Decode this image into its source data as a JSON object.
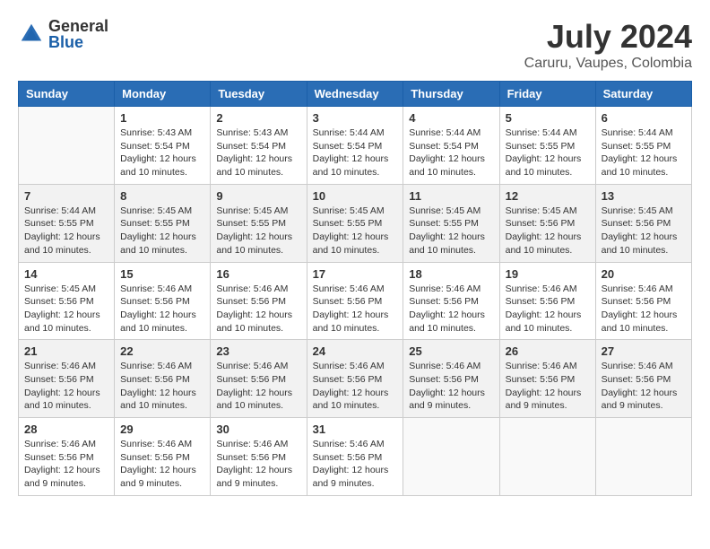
{
  "logo": {
    "general": "General",
    "blue": "Blue"
  },
  "title": "July 2024",
  "location": "Caruru, Vaupes, Colombia",
  "days_of_week": [
    "Sunday",
    "Monday",
    "Tuesday",
    "Wednesday",
    "Thursday",
    "Friday",
    "Saturday"
  ],
  "weeks": [
    [
      {
        "day": "",
        "info": ""
      },
      {
        "day": "1",
        "info": "Sunrise: 5:43 AM\nSunset: 5:54 PM\nDaylight: 12 hours\nand 10 minutes."
      },
      {
        "day": "2",
        "info": "Sunrise: 5:43 AM\nSunset: 5:54 PM\nDaylight: 12 hours\nand 10 minutes."
      },
      {
        "day": "3",
        "info": "Sunrise: 5:44 AM\nSunset: 5:54 PM\nDaylight: 12 hours\nand 10 minutes."
      },
      {
        "day": "4",
        "info": "Sunrise: 5:44 AM\nSunset: 5:54 PM\nDaylight: 12 hours\nand 10 minutes."
      },
      {
        "day": "5",
        "info": "Sunrise: 5:44 AM\nSunset: 5:55 PM\nDaylight: 12 hours\nand 10 minutes."
      },
      {
        "day": "6",
        "info": "Sunrise: 5:44 AM\nSunset: 5:55 PM\nDaylight: 12 hours\nand 10 minutes."
      }
    ],
    [
      {
        "day": "7",
        "info": "Sunrise: 5:44 AM\nSunset: 5:55 PM\nDaylight: 12 hours\nand 10 minutes."
      },
      {
        "day": "8",
        "info": "Sunrise: 5:45 AM\nSunset: 5:55 PM\nDaylight: 12 hours\nand 10 minutes."
      },
      {
        "day": "9",
        "info": "Sunrise: 5:45 AM\nSunset: 5:55 PM\nDaylight: 12 hours\nand 10 minutes."
      },
      {
        "day": "10",
        "info": "Sunrise: 5:45 AM\nSunset: 5:55 PM\nDaylight: 12 hours\nand 10 minutes."
      },
      {
        "day": "11",
        "info": "Sunrise: 5:45 AM\nSunset: 5:55 PM\nDaylight: 12 hours\nand 10 minutes."
      },
      {
        "day": "12",
        "info": "Sunrise: 5:45 AM\nSunset: 5:56 PM\nDaylight: 12 hours\nand 10 minutes."
      },
      {
        "day": "13",
        "info": "Sunrise: 5:45 AM\nSunset: 5:56 PM\nDaylight: 12 hours\nand 10 minutes."
      }
    ],
    [
      {
        "day": "14",
        "info": "Sunrise: 5:45 AM\nSunset: 5:56 PM\nDaylight: 12 hours\nand 10 minutes."
      },
      {
        "day": "15",
        "info": "Sunrise: 5:46 AM\nSunset: 5:56 PM\nDaylight: 12 hours\nand 10 minutes."
      },
      {
        "day": "16",
        "info": "Sunrise: 5:46 AM\nSunset: 5:56 PM\nDaylight: 12 hours\nand 10 minutes."
      },
      {
        "day": "17",
        "info": "Sunrise: 5:46 AM\nSunset: 5:56 PM\nDaylight: 12 hours\nand 10 minutes."
      },
      {
        "day": "18",
        "info": "Sunrise: 5:46 AM\nSunset: 5:56 PM\nDaylight: 12 hours\nand 10 minutes."
      },
      {
        "day": "19",
        "info": "Sunrise: 5:46 AM\nSunset: 5:56 PM\nDaylight: 12 hours\nand 10 minutes."
      },
      {
        "day": "20",
        "info": "Sunrise: 5:46 AM\nSunset: 5:56 PM\nDaylight: 12 hours\nand 10 minutes."
      }
    ],
    [
      {
        "day": "21",
        "info": "Sunrise: 5:46 AM\nSunset: 5:56 PM\nDaylight: 12 hours\nand 10 minutes."
      },
      {
        "day": "22",
        "info": "Sunrise: 5:46 AM\nSunset: 5:56 PM\nDaylight: 12 hours\nand 10 minutes."
      },
      {
        "day": "23",
        "info": "Sunrise: 5:46 AM\nSunset: 5:56 PM\nDaylight: 12 hours\nand 10 minutes."
      },
      {
        "day": "24",
        "info": "Sunrise: 5:46 AM\nSunset: 5:56 PM\nDaylight: 12 hours\nand 10 minutes."
      },
      {
        "day": "25",
        "info": "Sunrise: 5:46 AM\nSunset: 5:56 PM\nDaylight: 12 hours\nand 9 minutes."
      },
      {
        "day": "26",
        "info": "Sunrise: 5:46 AM\nSunset: 5:56 PM\nDaylight: 12 hours\nand 9 minutes."
      },
      {
        "day": "27",
        "info": "Sunrise: 5:46 AM\nSunset: 5:56 PM\nDaylight: 12 hours\nand 9 minutes."
      }
    ],
    [
      {
        "day": "28",
        "info": "Sunrise: 5:46 AM\nSunset: 5:56 PM\nDaylight: 12 hours\nand 9 minutes."
      },
      {
        "day": "29",
        "info": "Sunrise: 5:46 AM\nSunset: 5:56 PM\nDaylight: 12 hours\nand 9 minutes."
      },
      {
        "day": "30",
        "info": "Sunrise: 5:46 AM\nSunset: 5:56 PM\nDaylight: 12 hours\nand 9 minutes."
      },
      {
        "day": "31",
        "info": "Sunrise: 5:46 AM\nSunset: 5:56 PM\nDaylight: 12 hours\nand 9 minutes."
      },
      {
        "day": "",
        "info": ""
      },
      {
        "day": "",
        "info": ""
      },
      {
        "day": "",
        "info": ""
      }
    ]
  ],
  "shaded_rows": [
    1,
    3
  ]
}
